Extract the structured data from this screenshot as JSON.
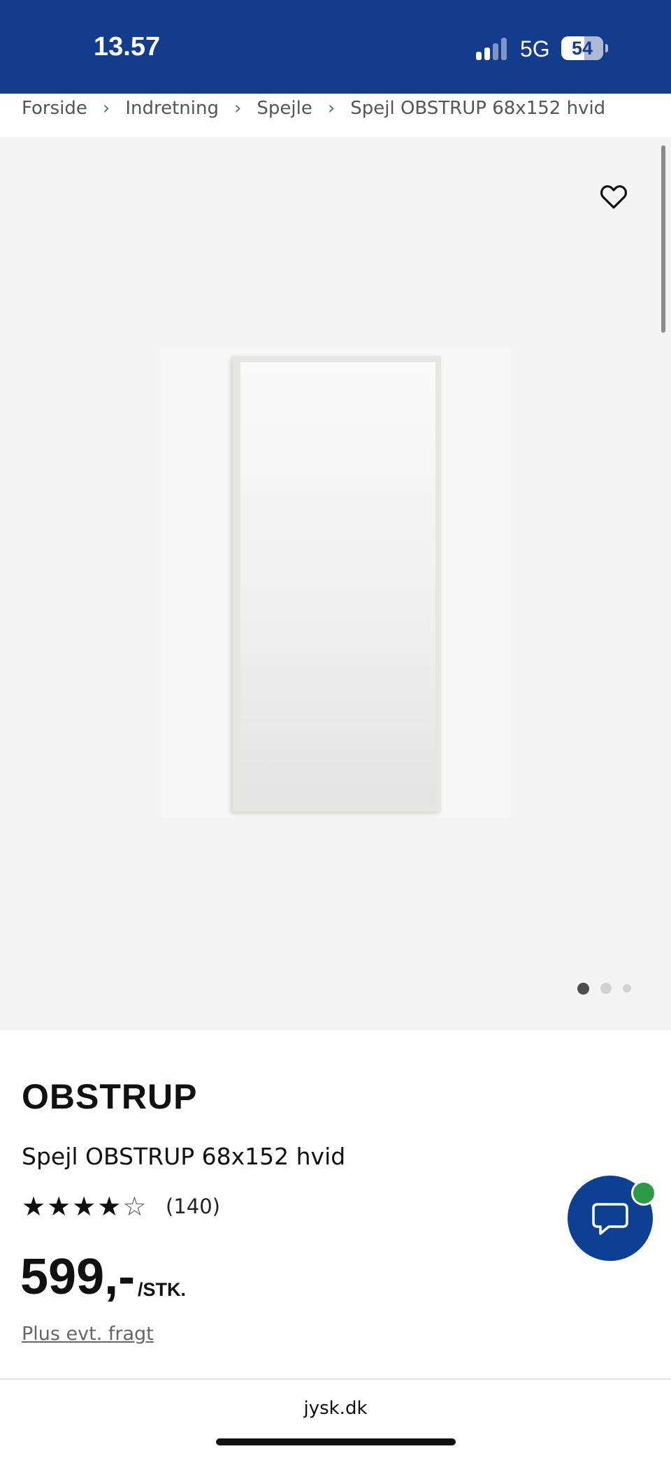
{
  "status_bar": {
    "time": "13.57",
    "network": "5G",
    "battery": "54",
    "battery_level": 0.54,
    "background": "#143c8c"
  },
  "breadcrumb": [
    "Forside",
    "Indretning",
    "Spejle",
    "Spejl OBSTRUP 68x152 hvid"
  ],
  "gallery": {
    "image_count": 3,
    "active_index": 0,
    "favorite_icon": "heart-outline-icon"
  },
  "product": {
    "brand": "OBSTRUP",
    "name": "Spejl OBSTRUP 68x152 hvid",
    "rating": 4,
    "rating_max": 5,
    "review_count": "(140)",
    "price": "599,-",
    "unit": "/STK.",
    "shipping_note": "Plus evt. fragt"
  },
  "chat": {
    "icon": "chat-bubble-icon",
    "online": true,
    "color": "#0d3f93",
    "status_color": "#2e9a47"
  },
  "browser": {
    "url": "jysk.dk"
  }
}
